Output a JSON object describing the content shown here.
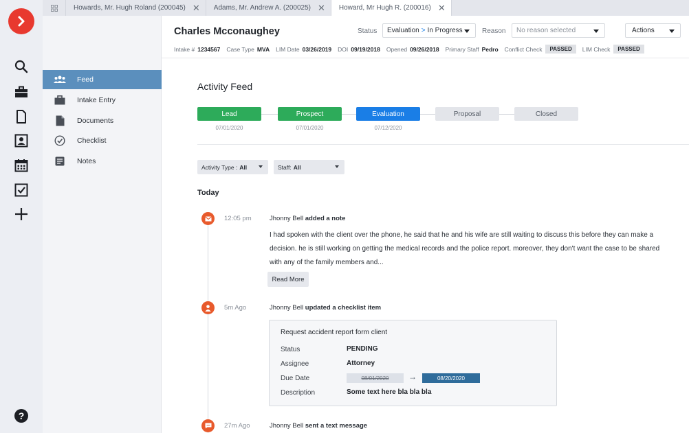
{
  "tabs": [
    {
      "label": "Howards, Mr. Hugh Roland (200045)",
      "active": false
    },
    {
      "label": "Adams, Mr. Andrew A. (200025)",
      "active": false
    },
    {
      "label": "Howard, Mr Hugh R. (200016)",
      "active": true
    }
  ],
  "rail": {
    "icons": [
      "search-icon",
      "briefcase-icon",
      "document-icon",
      "contact-icon",
      "calendar-icon",
      "checkbox-icon",
      "plus-icon"
    ],
    "help": "?"
  },
  "sidebar": {
    "items": [
      {
        "label": "Feed",
        "icon": "people-icon",
        "active": true
      },
      {
        "label": "Intake Entry",
        "icon": "briefcase-icon",
        "active": false
      },
      {
        "label": "Documents",
        "icon": "document-icon",
        "active": false
      },
      {
        "label": "Checklist",
        "icon": "check-circle-icon",
        "active": false
      },
      {
        "label": "Notes",
        "icon": "notes-icon",
        "active": false
      }
    ]
  },
  "header": {
    "name": "Charles Mcconaughey",
    "status_label": "Status",
    "status_from": "Evaluation",
    "status_sep": ">",
    "status_to": "In Progress",
    "reason_label": "Reason",
    "reason_placeholder": "No reason selected",
    "actions_label": "Actions",
    "meta": {
      "intake_label": "Intake #",
      "intake": "1234567",
      "case_type_label": "Case Type",
      "case_type": "MVA",
      "lim_date_label": "LIM Date",
      "lim_date": "03/26/2019",
      "doi_label": "DOI",
      "doi": "09/19/2018",
      "opened_label": "Opened",
      "opened": "09/26/2018",
      "staff_label": "Primary Staff",
      "staff": "Pedro",
      "conflict_label": "Conflict Check",
      "conflict": "PASSED",
      "lim_check_label": "LIM Check",
      "lim_check": "PASSED"
    }
  },
  "main": {
    "title": "Activity Feed",
    "stages": [
      {
        "label": "Lead",
        "date": "07/01/2020",
        "state": "done"
      },
      {
        "label": "Prospect",
        "date": "07/01/2020",
        "state": "done"
      },
      {
        "label": "Evaluation",
        "date": "07/12/2020",
        "state": "current"
      },
      {
        "label": "Proposal",
        "date": "",
        "state": "todo"
      },
      {
        "label": "Closed",
        "date": "",
        "state": "todo"
      }
    ],
    "filters": {
      "activity_label": "Activity Type :",
      "activity_value": "All",
      "staff_label": "Staff:",
      "staff_value": "All"
    },
    "day_heading": "Today",
    "activities": [
      {
        "time": "12:05 pm",
        "actor": "Jhonny Bell",
        "action": "added a note",
        "icon": "mail-icon",
        "note": "I had spoken with the client over the phone, he said that he and his wife are still waiting to discuss this before they can make a decision. he is still working on getting the medical records and the police report. moreover, they don't want the case to be shared with any of the family members and...",
        "read_more": "Read More"
      },
      {
        "time": "5m Ago",
        "actor": "Jhonny Bell",
        "action": "updated a checklist item",
        "icon": "user-icon",
        "card": {
          "title": "Request accident report form client",
          "status_label": "Status",
          "status": "PENDING",
          "assignee_label": "Assignee",
          "assignee": "Attorney",
          "due_label": "Due Date",
          "due_old": "08/01/2020",
          "due_new": "08/20/2020",
          "desc_label": "Description",
          "desc": "Some text here bla bla bla"
        }
      },
      {
        "time": "27m Ago",
        "actor": "Jhonny Bell",
        "action": "sent a text message",
        "icon": "chat-icon"
      }
    ]
  }
}
